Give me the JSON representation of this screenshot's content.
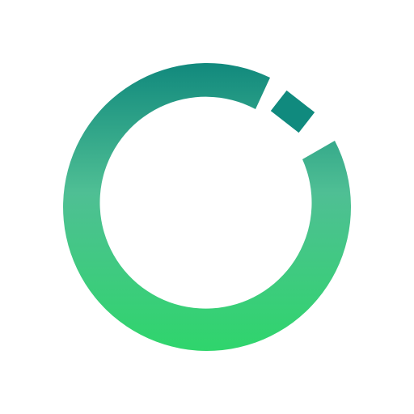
{
  "icon": {
    "name": "ring-logo-icon",
    "gradient_top": "#11897d",
    "gradient_mid": "#4fbf94",
    "gradient_bottom": "#2fd56c",
    "square_color": "#108a7e",
    "background": "#ffffff"
  }
}
